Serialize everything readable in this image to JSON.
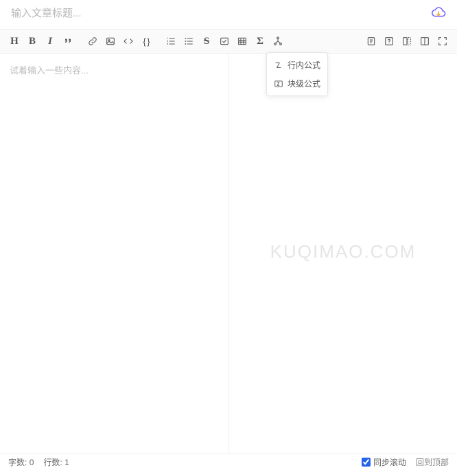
{
  "title": {
    "placeholder": "输入文章标题..."
  },
  "toolbar": {
    "heading": "H",
    "braces": "{ }"
  },
  "editor": {
    "placeholder": "试着输入一些内容..."
  },
  "watermark": "KUQIMAO.COM",
  "dropdown": {
    "inline": "行内公式",
    "block": "块级公式"
  },
  "status": {
    "chars_label": "字数:",
    "chars_value": "0",
    "lines_label": "行数:",
    "lines_value": "1",
    "sync_label": "同步滚动",
    "top_label": "回到顶部"
  }
}
